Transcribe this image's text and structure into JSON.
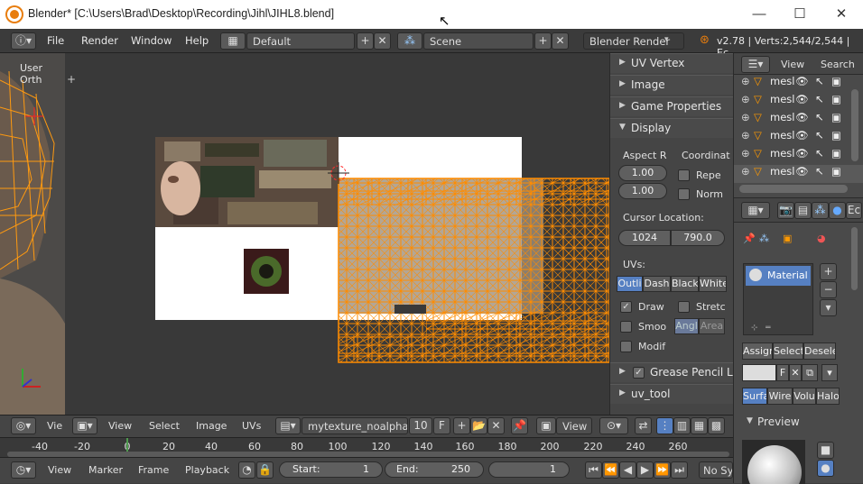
{
  "window": {
    "title": "Blender* [C:\\Users\\Brad\\Desktop\\Recording\\Jihl\\JIHL8.blend]",
    "controls": [
      "—",
      "☐",
      "✕"
    ]
  },
  "infobar": {
    "menus": [
      "File",
      "Render",
      "Window",
      "Help"
    ],
    "layout": "Default",
    "scene": "Scene",
    "engine": "Blender Render",
    "stats": "v2.78 | Verts:2,544/2,544 | Ec"
  },
  "viewport3d": {
    "label": "User Orth"
  },
  "npanel": {
    "sections_collapsed": [
      "UV Vertex",
      "Image",
      "Game Properties"
    ],
    "display_title": "Display",
    "aspect_label": "Aspect R",
    "aspect_x": "1.00",
    "aspect_y": "1.00",
    "coord_label": "Coordinat",
    "repeat_label": "Repe",
    "normalized_label": "Norm",
    "cursor_label": "Cursor Location:",
    "cursor_x": "1024",
    "cursor_y": "790.0",
    "uvs_label": "UVs:",
    "uv_modes": [
      "Outli",
      "Dash",
      "Black",
      "White"
    ],
    "draw_label": "Draw",
    "stretch_label": "Stretc",
    "smooth_label": "Smoo",
    "angle_label": "Angl",
    "area_label": "Area",
    "modified_label": "Modif",
    "grease_label": "Grease Pencil La",
    "uvtool_label": "uv_tool"
  },
  "outliner": {
    "view": "View",
    "search": "Search",
    "rows": [
      "mesl",
      "mesl",
      "mesl",
      "mesl",
      "mesl",
      "mesl"
    ]
  },
  "properties": {
    "material_name": "Material",
    "assign": "Assign",
    "select": "Select",
    "deselect": "Desele",
    "f_label": "F",
    "surface_tabs": [
      "Surfa",
      "Wire",
      "Volu",
      "Halo"
    ],
    "preview": "Preview"
  },
  "uv_header": {
    "view": "View",
    "select": "Select",
    "image": "Image",
    "uvs": "UVs",
    "viewport_label": "Vie",
    "image_name": "mytexture_noalpha...",
    "users": "10",
    "fake": "F",
    "pivot_view": "View"
  },
  "ruler": {
    "ticks": [
      "-40",
      "-20",
      "0",
      "20",
      "40",
      "60",
      "80",
      "100",
      "120",
      "140",
      "160",
      "180",
      "200",
      "220",
      "240",
      "260"
    ]
  },
  "timeline": {
    "view": "View",
    "marker": "Marker",
    "frame": "Frame",
    "playback": "Playback",
    "start_label": "Start:",
    "start": "1",
    "end_label": "End:",
    "end": "250",
    "current": "1",
    "sync": "No Syr"
  },
  "colors": {
    "uv_orange": "#ff8c00",
    "selected_blue": "#5680c2",
    "panel_bg": "#454545"
  }
}
